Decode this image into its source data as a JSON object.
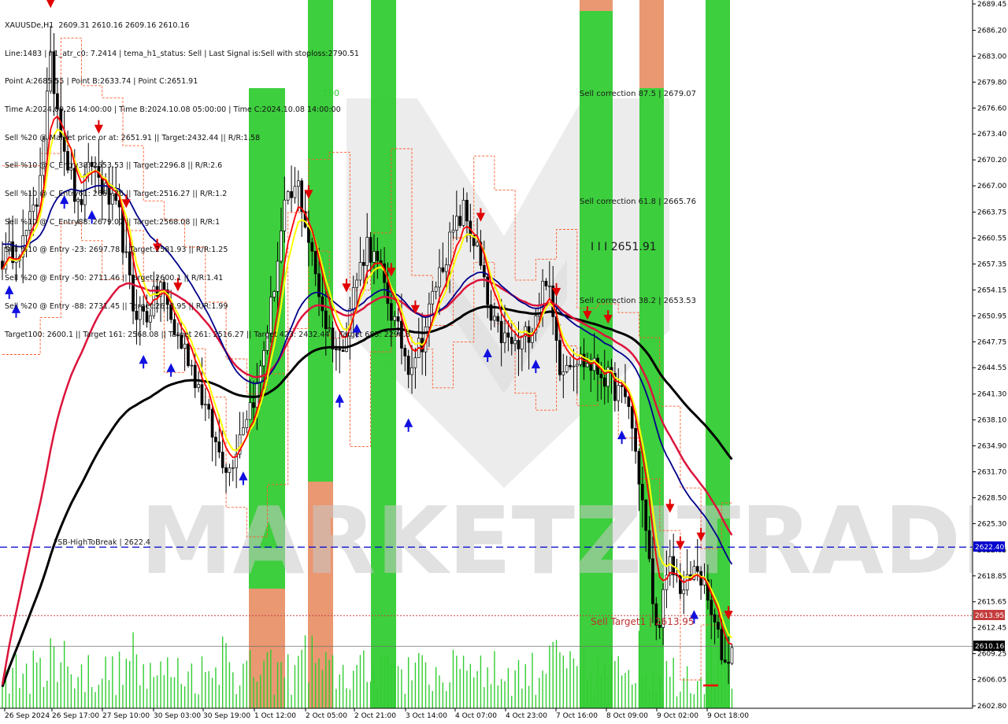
{
  "header": {
    "lines": [
      "XAUUSDe,H1  2609.31 2610.16 2609.16 2610.16",
      "Line:1483 | h1_atr_c0: 7.2414 | tema_h1_status: Sell | Last Signal is:Sell with stoploss:2790.51",
      "Point A:2685.55 | Point B:2633.74 | Point C:2651.91",
      "Time A:2024.09.26 14:00:00 | Time B:2024.10.08 05:00:00 | Time C:2024.10.08 14:00:00",
      "Sell %20 @ Market price or at: 2651.91 || Target:2432.44 || R/R:1.58",
      "Sell %10 @ C_Entry38: 2653.53 || Target:2296.8 || R/R:2.6",
      "Sell %10 @ C_Entry61: 2665.76 || Target:2516.27 || R/R:1.2",
      "Sell %10 @ C_Entry88: 2679.07 || Target:2568.08 || R/R:1",
      "Sell %10 @ Entry -23: 2697.78 || Target:2581.93 || R/R:1.25",
      "Sell %20 @ Entry -50: 2711.46 || Target:2600.1 || R/R:1.41",
      "Sell %20 @ Entry -88: 2731.45 || Target:2613.95 || R/R:1.99",
      "Target100: 2600.1 || Target 161: 2568.08 || Target 261: 2516.27 || Target 423: 2432.44 || Target 685: 2296.8"
    ]
  },
  "watermark": "MARKETZITRADE",
  "chart_data": {
    "type": "candlestick",
    "symbol": "XAUUSDe,H1",
    "ylim": [
      2602.8,
      2689.45
    ],
    "y_ticks": [
      "2689.45",
      "2686.20",
      "2683.00",
      "2679.80",
      "2676.60",
      "2673.40",
      "2670.20",
      "2667.00",
      "2663.75",
      "2660.55",
      "2657.35",
      "2654.15",
      "2650.95",
      "2647.75",
      "2644.55",
      "2641.30",
      "2638.10",
      "2634.90",
      "2631.70",
      "2628.50",
      "2625.30",
      "2622.05",
      "2618.85",
      "2615.65",
      "2612.45",
      "2609.25",
      "2606.05",
      "2602.80"
    ],
    "x_labels": [
      "26 Sep 2024",
      "26 Sep 17:00",
      "27 Sep 10:00",
      "30 Sep 03:00",
      "30 Sep 19:00",
      "1 Oct 12:00",
      "2 Oct 05:00",
      "2 Oct 21:00",
      "3 Oct 14:00",
      "4 Oct 07:00",
      "4 Oct 23:00",
      "7 Oct 16:00",
      "8 Oct 09:00",
      "9 Oct 02:00",
      "9 Oct 18:00"
    ],
    "ohlc_anchors": [
      [
        0,
        2658
      ],
      [
        6,
        2660
      ],
      [
        10,
        2665
      ],
      [
        14,
        2682
      ],
      [
        18,
        2672
      ],
      [
        22,
        2664
      ],
      [
        26,
        2670
      ],
      [
        30,
        2666
      ],
      [
        34,
        2663
      ],
      [
        38,
        2652
      ],
      [
        42,
        2651
      ],
      [
        46,
        2655
      ],
      [
        50,
        2649
      ],
      [
        54,
        2646
      ],
      [
        58,
        2641
      ],
      [
        62,
        2635
      ],
      [
        66,
        2632
      ],
      [
        70,
        2638
      ],
      [
        74,
        2642
      ],
      [
        78,
        2652
      ],
      [
        82,
        2664
      ],
      [
        86,
        2667
      ],
      [
        90,
        2658
      ],
      [
        94,
        2650
      ],
      [
        98,
        2646
      ],
      [
        102,
        2654
      ],
      [
        106,
        2660
      ],
      [
        110,
        2656
      ],
      [
        114,
        2650
      ],
      [
        118,
        2645
      ],
      [
        122,
        2648
      ],
      [
        126,
        2655
      ],
      [
        130,
        2660
      ],
      [
        134,
        2664
      ],
      [
        138,
        2659
      ],
      [
        142,
        2650
      ],
      [
        146,
        2648
      ],
      [
        150,
        2647
      ],
      [
        154,
        2650
      ],
      [
        158,
        2656
      ],
      [
        162,
        2645
      ],
      [
        166,
        2646
      ],
      [
        170,
        2645
      ],
      [
        174,
        2644
      ],
      [
        178,
        2642
      ],
      [
        182,
        2640
      ],
      [
        186,
        2628
      ],
      [
        190,
        2612
      ],
      [
        194,
        2620
      ],
      [
        198,
        2617
      ],
      [
        202,
        2620
      ],
      [
        206,
        2614
      ],
      [
        210,
        2608
      ],
      [
        212,
        2610
      ]
    ],
    "levels": {
      "fsb_high_to_break": {
        "label": "FSB-HighToBreak | 2622.4",
        "value": 2622.4,
        "tag": "2622.40"
      },
      "sell_target": {
        "label": "Sell Target1 | 2613.95",
        "value": 2613.95,
        "tag": "2613.95"
      },
      "current_price": {
        "value": 2610.16,
        "tag": "2610.16"
      },
      "sell_correction_875": {
        "label": "Sell correction 87.5 | 2679.07",
        "value": 2679.07
      },
      "sell_correction_618": {
        "label": "Sell correction 61.8 | 2665.76",
        "value": 2665.76
      },
      "sell_correction_382": {
        "label": "Sell correction 38.2 | 2653.53",
        "value": 2653.53
      },
      "point_c": {
        "label": "I I I 2651.91",
        "value": 2651.91
      }
    },
    "marker_100": "100",
    "colors": {
      "green_zone": "#33cc33",
      "orange_zone": "#e8926a",
      "blue_ma": "#00008b",
      "red_ma": "#dc143c",
      "black_ma": "#000000",
      "fast_red": "#ff0000",
      "fast_yellow": "#ffff00",
      "volume": "#32cd32",
      "hline_blue": "#0000cd",
      "hline_red": "#c04040"
    }
  }
}
